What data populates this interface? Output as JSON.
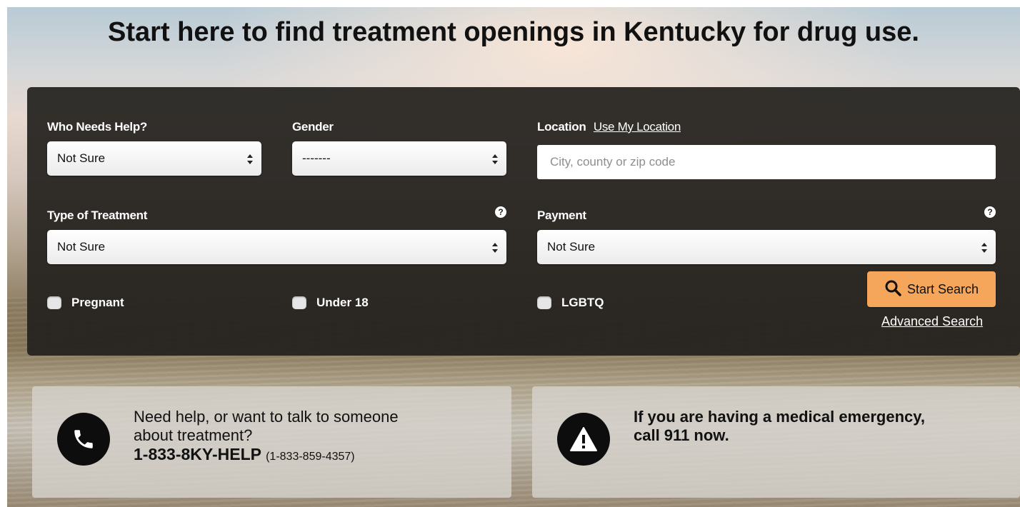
{
  "headline": "Start here to find treatment openings in Kentucky for drug use.",
  "form": {
    "who_label": "Who Needs Help?",
    "who_value": "Not Sure",
    "gender_label": "Gender",
    "gender_value": "-------",
    "location_label": "Location",
    "use_my_location": "Use My Location",
    "location_placeholder": "City, county or zip code",
    "treatment_label": "Type of Treatment",
    "treatment_value": "Not Sure",
    "payment_label": "Payment",
    "payment_value": "Not Sure",
    "help_glyph": "?",
    "checkboxes": [
      "Pregnant",
      "Under 18",
      "LGBTQ"
    ],
    "search_button": "Start Search",
    "advanced_search": "Advanced Search"
  },
  "cards": {
    "help_line1": "Need help, or want to talk to someone",
    "help_line2": "about treatment?",
    "phone_main": "1-833-8KY-HELP",
    "phone_numeric": "(1-833-859-4357)",
    "emergency_line1": "If you are having a medical emergency,",
    "emergency_line2": "call 911 now."
  },
  "colors": {
    "panel": "#24211e",
    "search_button": "#f5a65b"
  },
  "icons": {
    "phone": "phone-icon",
    "warning": "warning-icon",
    "search": "search-icon",
    "help": "question-icon",
    "select_arrows": "select-arrows-icon"
  }
}
